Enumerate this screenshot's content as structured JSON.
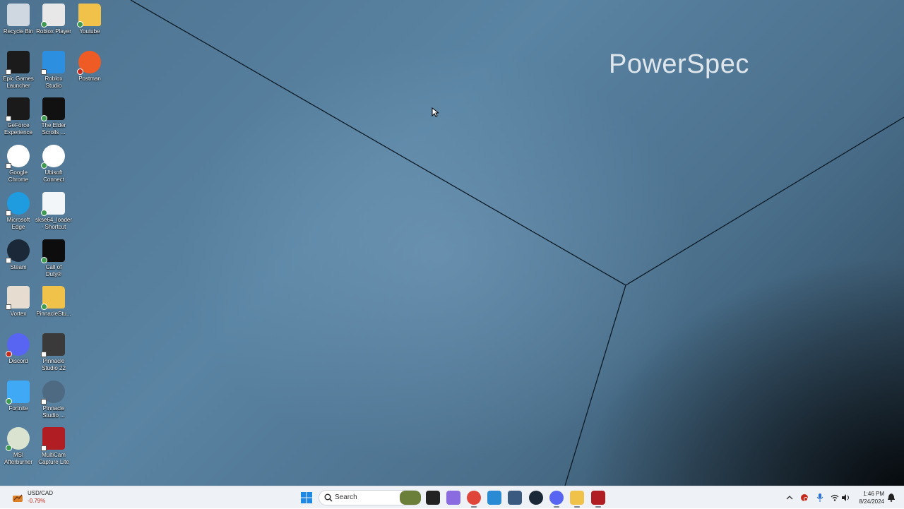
{
  "wallpaper": {
    "brand_text": "PowerSpec"
  },
  "desktop_icons": [
    {
      "label": "Recycle Bin",
      "icon": "recycle-bin-icon",
      "badge": "none",
      "color": "#cfd8e0"
    },
    {
      "label": "Roblox Player",
      "icon": "roblox-player-icon",
      "badge": "ok",
      "color": "#e8e8e8"
    },
    {
      "label": "Youtube",
      "icon": "folder-icon",
      "badge": "ok",
      "color": "#f0c24a"
    },
    {
      "label": "Epic Games\nLauncher",
      "icon": "epic-games-icon",
      "badge": "sc",
      "color": "#1b1b1b"
    },
    {
      "label": "Roblox\nStudio",
      "icon": "roblox-studio-icon",
      "badge": "sc",
      "color": "#2d8fe0"
    },
    {
      "label": "Postman",
      "icon": "postman-icon",
      "badge": "err",
      "color": "#ef5b25"
    },
    {
      "label": "GeForce\nExperience",
      "icon": "geforce-icon",
      "badge": "sc",
      "color": "#1a1a1a"
    },
    {
      "label": "The Elder\nScrolls ...",
      "icon": "elder-scrolls-icon",
      "badge": "ok",
      "color": "#111111"
    },
    {
      "label": "Google\nChrome",
      "icon": "chrome-icon",
      "badge": "sc",
      "color": "#ffffff"
    },
    {
      "label": "Ubisoft\nConnect",
      "icon": "ubisoft-icon",
      "badge": "ok",
      "color": "#ffffff"
    },
    {
      "label": "Microsoft\nEdge",
      "icon": "edge-icon",
      "badge": "sc",
      "color": "#1f9be0"
    },
    {
      "label": "skse64_loader\n- Shortcut",
      "icon": "skse-icon",
      "badge": "ok",
      "color": "#f3f6f9"
    },
    {
      "label": "Steam",
      "icon": "steam-icon",
      "badge": "sc",
      "color": "#1b2838"
    },
    {
      "label": "Call of\nDuty®",
      "icon": "call-of-duty-icon",
      "badge": "ok",
      "color": "#0d0d0d"
    },
    {
      "label": "Vortex",
      "icon": "vortex-icon",
      "badge": "sc",
      "color": "#e6ddd0"
    },
    {
      "label": "PinnacleStu...",
      "icon": "folder-icon",
      "badge": "ok",
      "color": "#f0c24a"
    },
    {
      "label": "Discord",
      "icon": "discord-icon",
      "badge": "err",
      "color": "#5865f2"
    },
    {
      "label": "Pinnacle\nStudio 22",
      "icon": "pinnacle-studio-icon",
      "badge": "sc",
      "color": "#3a3a3a"
    },
    {
      "label": "Fortnite",
      "icon": "fortnite-icon",
      "badge": "ok",
      "color": "#3fa9f5"
    },
    {
      "label": "Pinnacle\nStudio ...",
      "icon": "pinnacle-sb-icon",
      "badge": "sc",
      "color": "#4d6a82"
    },
    {
      "label": "MSI\nAfterburner",
      "icon": "msi-afterburner-icon",
      "badge": "ok",
      "color": "#d9e3d0"
    },
    {
      "label": "MultiCam\nCapture Lite",
      "icon": "multicam-icon",
      "badge": "sc",
      "color": "#b01e23"
    }
  ],
  "taskbar": {
    "widget": {
      "label": "USD/CAD",
      "value": "-0.79%",
      "icon": "stock-chart-icon"
    },
    "start_icon": "windows-start-icon",
    "search": {
      "placeholder": "Search",
      "icon": "search-icon"
    },
    "pinned": [
      {
        "name": "tank-game-icon",
        "color": "#6b7f3b"
      },
      {
        "name": "task-view-icon",
        "color": "#222222"
      },
      {
        "name": "copilot-icon",
        "color": "#8a6be0"
      },
      {
        "name": "chrome-icon",
        "color": "#e0453a"
      },
      {
        "name": "vscode-icon",
        "color": "#2a8ad4"
      },
      {
        "name": "game-controller-icon",
        "color": "#3a5a80"
      },
      {
        "name": "steam-icon",
        "color": "#1b2838"
      },
      {
        "name": "discord-icon",
        "color": "#5865f2"
      },
      {
        "name": "file-explorer-icon",
        "color": "#f0c24a"
      },
      {
        "name": "multicam-icon",
        "color": "#b01e23"
      }
    ],
    "tray": {
      "icons": [
        "chevron-up-icon",
        "antivirus-icon",
        "microphone-icon",
        "wifi-icon",
        "volume-icon"
      ],
      "time": "1:46 PM",
      "date": "8/24/2024",
      "notification_icon": "notification-bell-icon"
    }
  }
}
